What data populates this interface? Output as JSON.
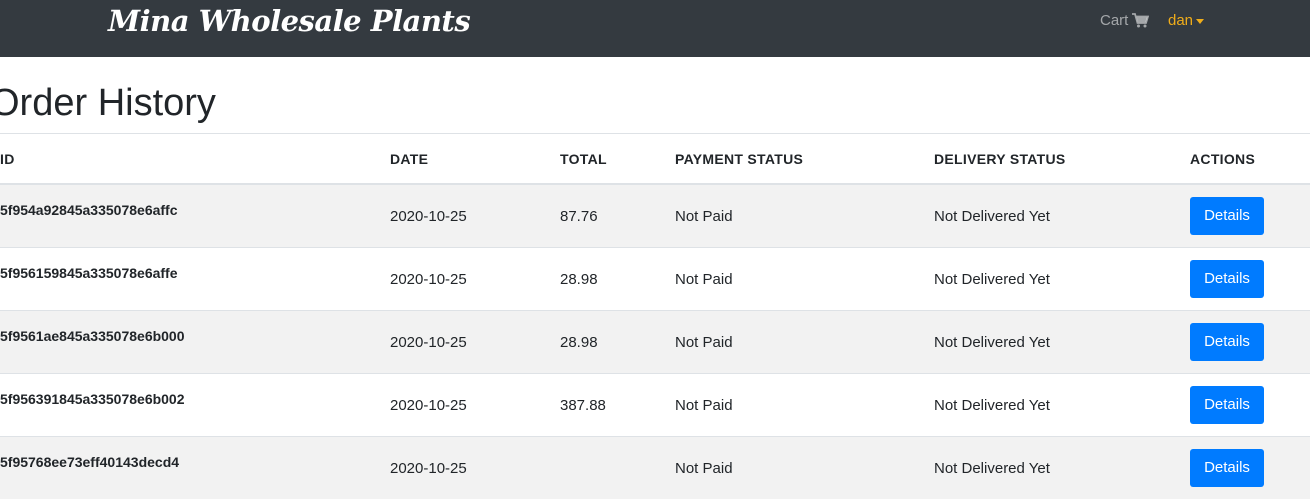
{
  "navbar": {
    "brand": "Mina Wholesale Plants",
    "cart_label": "Cart",
    "cart_icon": "shopping-cart-icon",
    "user_label": "dan",
    "user_caret_icon": "caret-down-icon",
    "accent_color": "#f0ad1a",
    "background_color": "#343a40"
  },
  "page": {
    "title": "Order History"
  },
  "table": {
    "headers": {
      "id": "ID",
      "date": "DATE",
      "total": "TOTAL",
      "payment": "PAYMENT STATUS",
      "delivery": "DELIVERY STATUS",
      "actions": "ACTIONS"
    },
    "rows": [
      {
        "id": "5f954a92845a335078e6affc",
        "date": "2020-10-25",
        "total": "87.76",
        "payment": "Not Paid",
        "delivery": "Not Delivered Yet",
        "action": "Details"
      },
      {
        "id": "5f956159845a335078e6affe",
        "date": "2020-10-25",
        "total": "28.98",
        "payment": "Not Paid",
        "delivery": "Not Delivered Yet",
        "action": "Details"
      },
      {
        "id": "5f9561ae845a335078e6b000",
        "date": "2020-10-25",
        "total": "28.98",
        "payment": "Not Paid",
        "delivery": "Not Delivered Yet",
        "action": "Details"
      },
      {
        "id": "5f956391845a335078e6b002",
        "date": "2020-10-25",
        "total": "387.88",
        "payment": "Not Paid",
        "delivery": "Not Delivered Yet",
        "action": "Details"
      },
      {
        "id": "5f95768ee73eff40143decd4",
        "date": "2020-10-25",
        "total": "",
        "payment": "Not Paid",
        "delivery": "Not Delivered Yet",
        "action": "Details"
      }
    ],
    "button_color": "#007bff"
  }
}
